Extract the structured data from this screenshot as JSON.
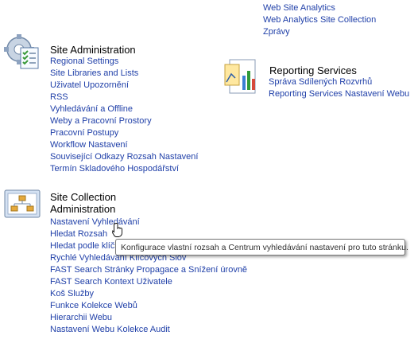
{
  "top_links": [
    "Web Site Analytics",
    "Web Analytics Site Collection",
    "Zprávy"
  ],
  "site_admin": {
    "title": "Site Administration",
    "icon": "settings-checklist-icon",
    "links": [
      "Regional Settings",
      "Site Libraries and Lists",
      "Uživatel Upozornění",
      "RSS",
      "Vyhledávání a Offline",
      "Weby a Pracovní Prostory",
      "Pracovní Postupy",
      "Workflow Nastavení",
      "Související Odkazy Rozsah Nastavení",
      "Termín Skladového Hospodářství"
    ]
  },
  "reporting": {
    "title": "Reporting Services",
    "icon": "report-chart-icon",
    "links": [
      "Správa Sdílených Rozvrhů",
      "Reporting Services Nastavení Webu"
    ]
  },
  "site_collection_admin": {
    "title_line1": "Site Collection",
    "title_line2": "Administration",
    "icon": "site-hierarchy-icon",
    "links": [
      "Nastavení Vyhledávání",
      "Hledat Rozsah",
      "Hledat podle klíč",
      "Rychlé Vyhledávání Klíčových Slov",
      "FAST Search Stránky Propagace a Snížení úrovně",
      "FAST Search Kontext Uživatele",
      "Koš Služby",
      "Funkce Kolekce Webů",
      "Hierarchii Webu",
      "Nastavení Webu Kolekce Audit"
    ]
  },
  "tooltip": "Konfigurace vlastní rozsah a Centrum vyhledávání nastavení pro tuto stránku.",
  "colors": {
    "link": "#1f3fa8",
    "heading": "#000000"
  }
}
